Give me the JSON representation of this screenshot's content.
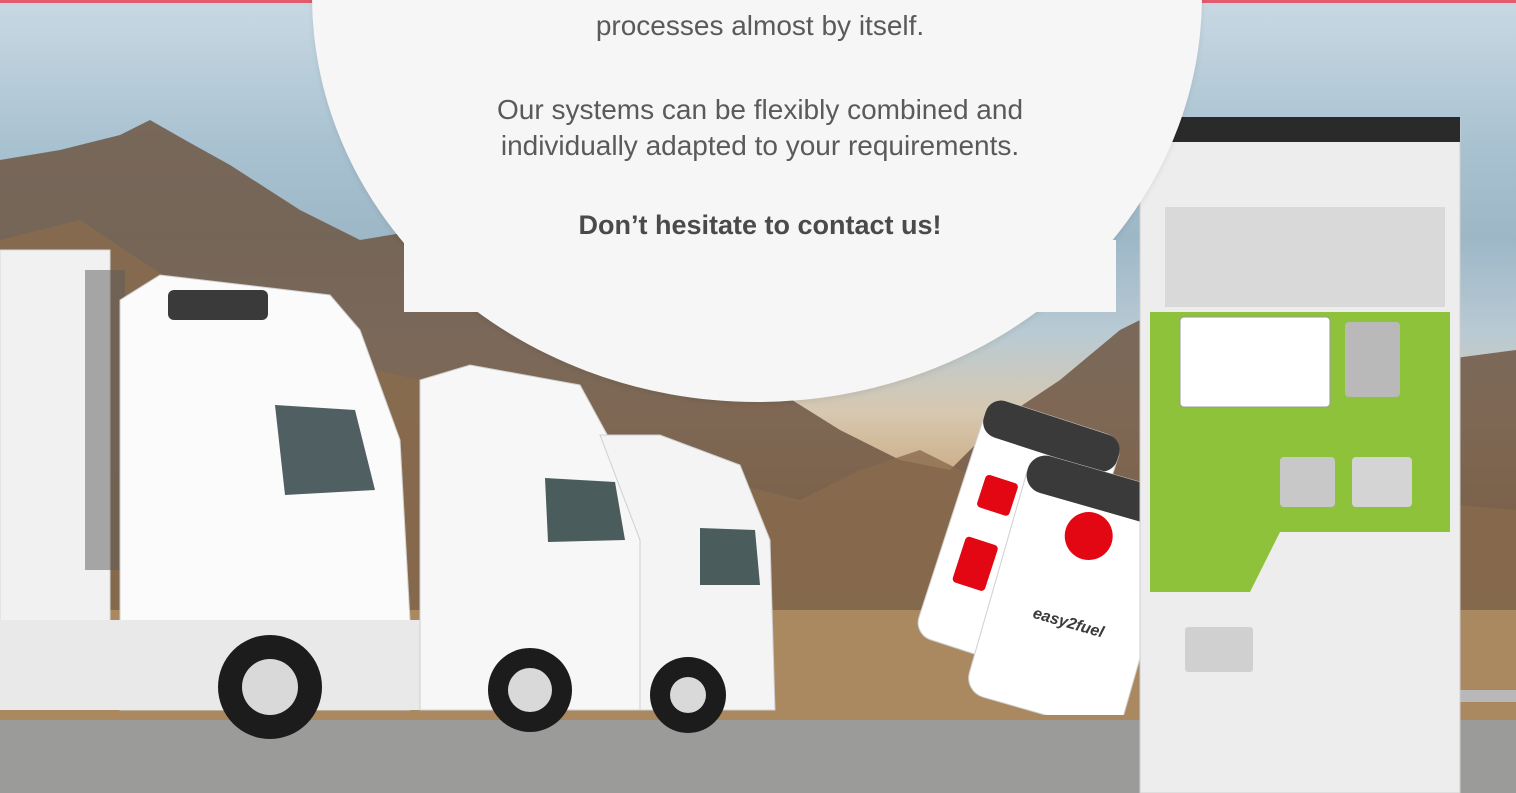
{
  "content": {
    "line1": "processes almost by itself.",
    "line2": "Our systems can be flexibly combined and",
    "line3": "individually adapted to your requirements.",
    "cta": "Don’t hesitate to contact us!"
  },
  "images": {
    "background": "mountain-desert-landscape",
    "trucks": "white-trucks-icon",
    "phones": "mobile-app-icon",
    "terminal": "fuel-terminal-icon"
  },
  "app": {
    "logo_text": "easy2fuel"
  },
  "colors": {
    "accent": "#e30613",
    "green": "#8fc23b",
    "bubble": "#f6f6f6",
    "text": "#5a5a5a"
  }
}
